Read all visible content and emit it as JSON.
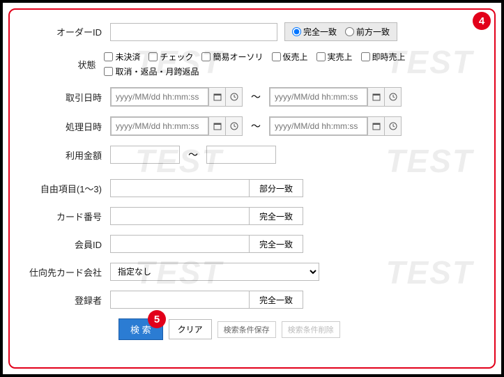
{
  "badges": {
    "b4": "4",
    "b5": "5"
  },
  "watermark": "TEST",
  "labels": {
    "order_id": "オーダーID",
    "status": "状態",
    "txn_date": "取引日時",
    "proc_date": "処理日時",
    "amount": "利用金額",
    "free_items": "自由項目(1〜3)",
    "card_no": "カード番号",
    "member_id": "会員ID",
    "dest_card_co": "仕向先カード会社",
    "registrant": "登録者"
  },
  "order_id": {
    "placeholder": "",
    "match_exact": "完全一致",
    "match_prefix": "前方一致"
  },
  "status_options": [
    "未決済",
    "チェック",
    "簡易オーソリ",
    "仮売上",
    "実売上",
    "即時売上",
    "取消・返品・月跨返品"
  ],
  "date": {
    "placeholder": "yyyy/MM/dd hh:mm:ss",
    "separator": "〜"
  },
  "amount": {
    "separator": "〜"
  },
  "match": {
    "partial": "部分一致",
    "exact": "完全一致"
  },
  "dest_card_co": {
    "selected": "指定なし"
  },
  "actions": {
    "search": "検 索",
    "clear": "クリア",
    "save_cond": "検索条件保存",
    "delete_cond": "検索条件削除"
  }
}
